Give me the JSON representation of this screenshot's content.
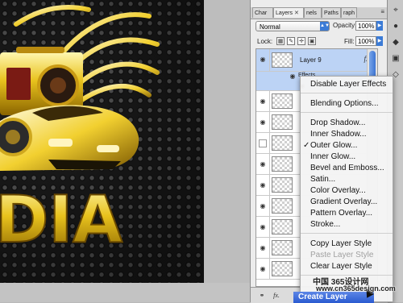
{
  "canvas": {
    "art_text": "DIA"
  },
  "panel": {
    "tabs": [
      {
        "label": "Char"
      },
      {
        "label": "Layers",
        "close": "✕"
      },
      {
        "label": "nels"
      },
      {
        "label": "Paths"
      },
      {
        "label": "raph"
      }
    ],
    "panel_menu_icon": "≡",
    "blend_mode": "Normal",
    "opacity_label": "Opacity:",
    "opacity_value": "100%",
    "lock_label": "Lock:",
    "fill_label": "Fill:",
    "fill_value": "100%",
    "layers": [
      {
        "name": "Layer 9",
        "fx": "fx",
        "selected": true
      },
      {
        "effects_label": "Effects"
      }
    ],
    "footer_icons": [
      "link-icon",
      "fx-icon"
    ]
  },
  "tools": [
    "move-icon",
    "brush-icon",
    "type-icon",
    "hand-icon"
  ],
  "context_menu": {
    "items": [
      {
        "label": "Disable Layer Effects"
      },
      {
        "label": "Blending Options..."
      },
      {
        "label": "Drop Shadow..."
      },
      {
        "label": "Inner Shadow..."
      },
      {
        "label": "Outer Glow...",
        "checked": true
      },
      {
        "label": "Inner Glow..."
      },
      {
        "label": "Bevel and Emboss..."
      },
      {
        "label": "Satin..."
      },
      {
        "label": "Color Overlay..."
      },
      {
        "label": "Gradient Overlay..."
      },
      {
        "label": "Pattern Overlay..."
      },
      {
        "label": "Stroke..."
      },
      {
        "label": "Copy Layer Style"
      },
      {
        "label": "Paste Layer Style",
        "disabled": true
      },
      {
        "label": "Clear Layer Style"
      }
    ],
    "check_mark": "✓",
    "highlighted": "Create Layer"
  },
  "watermark": {
    "line1": "中国 365设计网",
    "line2": "www.cn365design.com"
  },
  "colors": {
    "accent": "#3b7bd6",
    "gold": "#e6c020",
    "canvas_bg": "#1c1c1c"
  }
}
